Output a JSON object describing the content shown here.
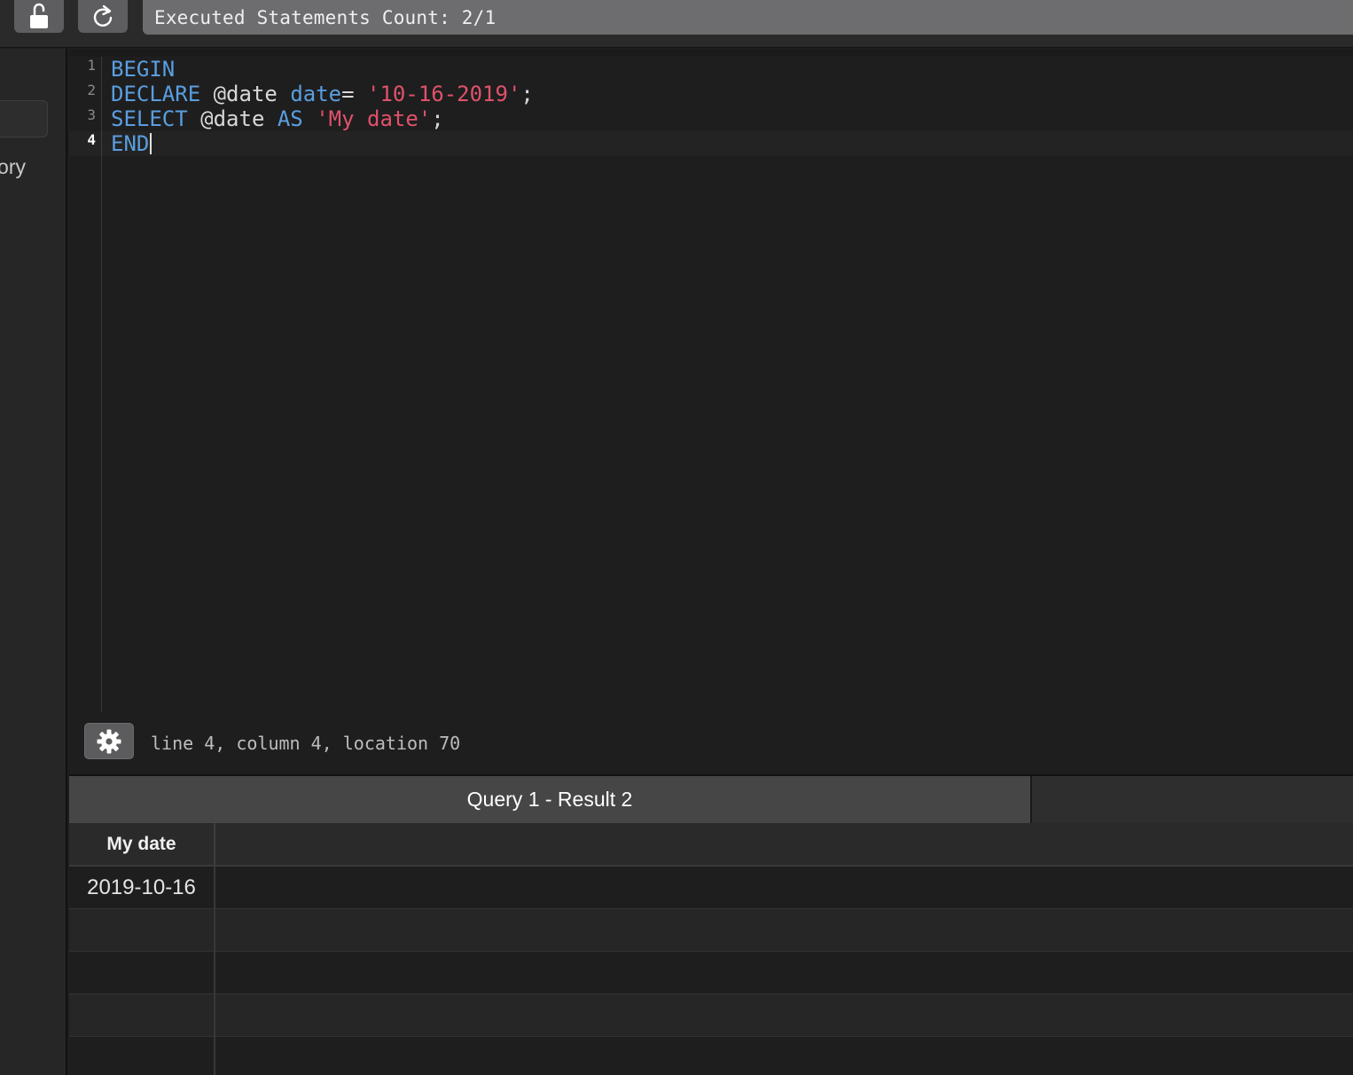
{
  "toolbar": {
    "lock_icon": "unlocked-padlock-icon",
    "refresh_icon": "refresh-icon",
    "status_text": "Executed Statements Count: 2/1"
  },
  "sidebar": {
    "partial_label": "ory"
  },
  "editor": {
    "line_numbers": [
      "1",
      "2",
      "3",
      "4"
    ],
    "active_line": 4,
    "code": {
      "line1": {
        "kw1": "BEGIN"
      },
      "line2": {
        "kw1": "DECLARE",
        "p1": " @date ",
        "kw2": "date",
        "p2": "= ",
        "str1": "'10-16-2019'",
        "p3": ";"
      },
      "line3": {
        "kw1": "SELECT",
        "p1": " @date ",
        "kw2": "AS",
        "p2": " ",
        "str1": "'My date'",
        "p3": ";"
      },
      "line4": {
        "kw1": "END"
      }
    },
    "settings_icon": "gear-icon",
    "cursor_info": "line 4, column 4, location 70"
  },
  "results": {
    "tab_label": "Query 1 - Result 2",
    "columns": [
      "My date"
    ],
    "rows": [
      [
        "2019-10-16"
      ],
      [
        ""
      ],
      [
        ""
      ],
      [
        ""
      ],
      [
        ""
      ]
    ]
  },
  "colors": {
    "keyword": "#5a9ee0",
    "string": "#e0516b",
    "background": "#1e1e1e"
  }
}
